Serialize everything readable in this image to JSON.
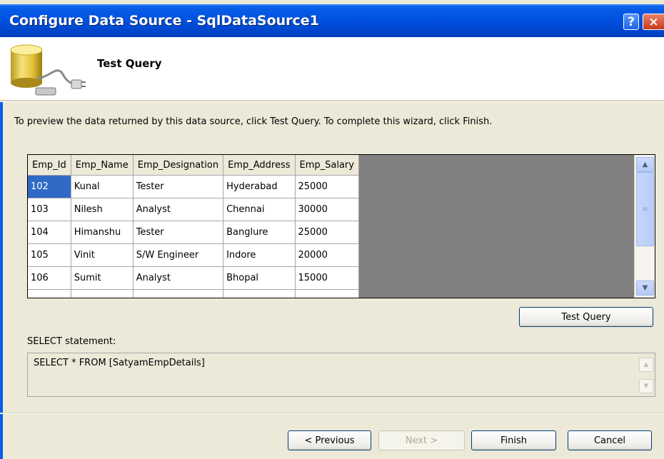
{
  "window": {
    "title": "Configure Data Source - SqlDataSource1",
    "help_label": "?",
    "close_label": "×"
  },
  "header": {
    "title": "Test Query",
    "icon": "database-plug-icon"
  },
  "instructions": "To preview the data returned by this data source, click Test Query. To complete this wizard, click Finish.",
  "grid": {
    "columns": [
      "Emp_Id",
      "Emp_Name",
      "Emp_Designation",
      "Emp_Address",
      "Emp_Salary"
    ],
    "rows": [
      [
        "102",
        "Kunal",
        "Tester",
        "Hyderabad",
        "25000"
      ],
      [
        "103",
        "Nilesh",
        "Analyst",
        "Chennai",
        "30000"
      ],
      [
        "104",
        "Himanshu",
        "Tester",
        "Banglure",
        "25000"
      ],
      [
        "105",
        "Vinit",
        "S/W Engineer",
        "Indore",
        "20000"
      ],
      [
        "106",
        "Sumit",
        "Analyst",
        "Bhopal",
        "15000"
      ]
    ]
  },
  "buttons": {
    "test_query": "Test Query",
    "previous": "< Previous",
    "next": "Next >",
    "finish": "Finish",
    "cancel": "Cancel"
  },
  "select_statement": {
    "label": "SELECT statement:",
    "value": "SELECT * FROM [SatyamEmpDetails]"
  },
  "colors": {
    "titlebar": "#0054e3",
    "selection": "#316ac5",
    "dialog_bg": "#ece9d8"
  }
}
